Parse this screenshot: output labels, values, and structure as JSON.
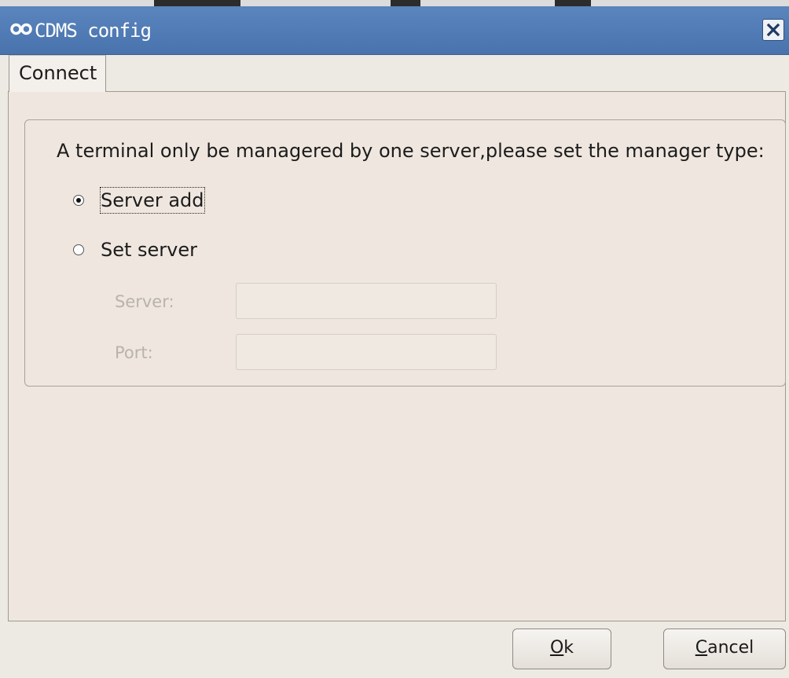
{
  "window": {
    "title": "CDMS config",
    "icon": "cdms-infinity-icon",
    "close_icon": "close-x-icon"
  },
  "tabs": [
    {
      "label": "Connect",
      "selected": true
    }
  ],
  "connect": {
    "prompt": "A terminal only be managered by one server,please set the manager type:",
    "options": [
      {
        "label": "Server add",
        "checked": true
      },
      {
        "label": "Set server",
        "checked": false
      }
    ],
    "server_label": "Server:",
    "server_value": "",
    "port_label": "Port:",
    "port_value": ""
  },
  "buttons": {
    "ok": {
      "mnemonic": "O",
      "rest": "k"
    },
    "cancel": {
      "mnemonic": "C",
      "rest": "ancel"
    }
  },
  "colors": {
    "titlebar": "#4f7bb4",
    "background": "#ede9e3"
  }
}
